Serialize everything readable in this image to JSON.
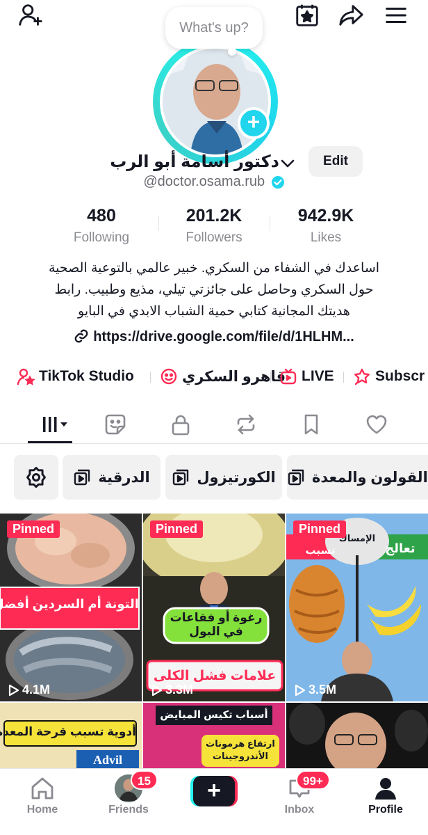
{
  "header": {
    "bubble_text": "What's up?"
  },
  "profile": {
    "display_name": "دكتور أسامة أبو الرب",
    "edit_label": "Edit",
    "username": "@doctor.osama.rub",
    "verified": true
  },
  "stats": [
    {
      "value": "480",
      "label": "Following"
    },
    {
      "value": "201.2K",
      "label": "Followers"
    },
    {
      "value": "942.9K",
      "label": "Likes"
    }
  ],
  "bio": {
    "line1": "اساعدك في الشفاء من السكري. خبير عالمي بالتوعية الصحية",
    "line2": "حول السكري وحاصل على جائزتي تيلي، مذيع وطبيب. رابط",
    "line3": "هديتك المجانية كتابي حمية الشباب الابدي في البايو",
    "link": "https://drive.google.com/file/d/1HLHM..."
  },
  "shortcuts": [
    {
      "label": "TikTok Studio",
      "icon": "studio-icon"
    },
    {
      "label": "قاهرو السكري",
      "icon": "group-icon"
    },
    {
      "label": "LIVE",
      "icon": "live-tv-icon"
    },
    {
      "label": "Subscr",
      "icon": "subscription-icon"
    }
  ],
  "tabs": [
    {
      "name": "videos-grid",
      "icon": "grid-icon",
      "active": true
    },
    {
      "name": "stickers",
      "icon": "sticker-icon"
    },
    {
      "name": "private",
      "icon": "lock-icon"
    },
    {
      "name": "reposts",
      "icon": "repost-icon"
    },
    {
      "name": "favorites",
      "icon": "bookmark-icon"
    },
    {
      "name": "liked",
      "icon": "heart-icon"
    }
  ],
  "playlists": [
    {
      "label": "الدرقية"
    },
    {
      "label": "الكورتيزول"
    },
    {
      "label": "القولون والمعدة"
    }
  ],
  "videos": [
    {
      "pinned_label": "Pinned",
      "views": "4.1M",
      "overlay": "التونة أم السردين أفضل؟"
    },
    {
      "pinned_label": "Pinned",
      "views": "3.3M",
      "overlay_top": "رغوة أو فقاعات",
      "overlay_mid": "في البول",
      "overlay_bottom": "علامات فشل الكلى"
    },
    {
      "pinned_label": "Pinned",
      "views": "3.5M",
      "overlay_top": "الإمساك",
      "overlay_left": "تسبب",
      "overlay_right": "تعالج"
    },
    {
      "overlay": "أدوية تسبب قرحة المعدة",
      "brand": "Advil"
    },
    {
      "overlay_top": "أسباب تكيس المبايض",
      "overlay_mid": "ارتفاع هرمونات",
      "overlay_bottom": "الأندروجينات"
    },
    {}
  ],
  "bottom_nav": {
    "home": "Home",
    "friends": "Friends",
    "friends_badge": "15",
    "inbox": "Inbox",
    "inbox_badge": "99+",
    "profile": "Profile"
  },
  "colors": {
    "accent": "#fe2c55",
    "cyan": "#25f4ee",
    "text": "#161823",
    "muted": "#8a8b91"
  }
}
